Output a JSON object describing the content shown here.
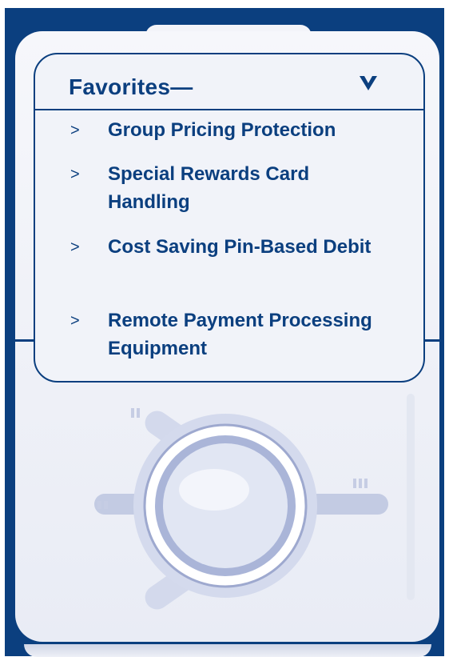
{
  "panel": {
    "title": "Favorites—",
    "items": [
      {
        "label": "Group Pricing Protection",
        "arrow": ">"
      },
      {
        "label": "Special Rewards Card Handling",
        "arrow": ">"
      },
      {
        "label": "Cost Saving Pin-Based Debit",
        "arrow": ">"
      },
      {
        "label": "Remote Payment Processing Equipment",
        "arrow": ">"
      }
    ]
  },
  "colors": {
    "brand": "#0b3f7f",
    "device": "#f1f3f9",
    "dial": "#b5bfdc"
  },
  "icons": {
    "collapse": "chevron-down-icon",
    "dial": "click-wheel-icon"
  }
}
